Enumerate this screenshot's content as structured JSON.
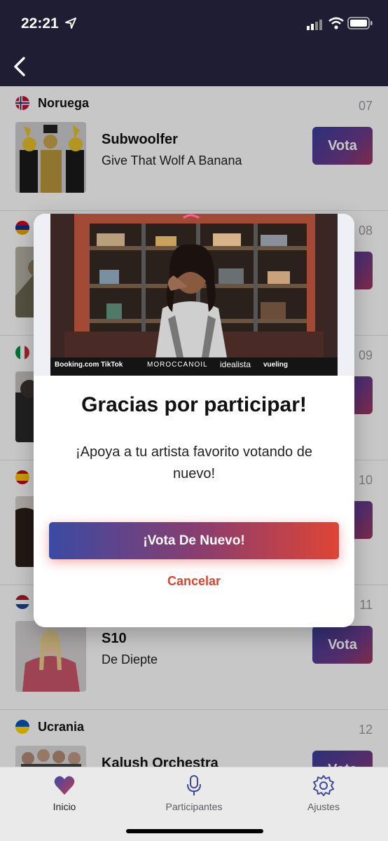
{
  "status_bar": {
    "time": "22:21",
    "icons": [
      "location-arrow-icon",
      "cellular-signal-icon",
      "wifi-icon",
      "battery-icon"
    ]
  },
  "nav": {
    "back_icon": "chevron-left-icon"
  },
  "entries": [
    {
      "country": "Noruega",
      "number": "07",
      "artist": "Subwoolfer",
      "song": "Give That Wolf A Banana",
      "vote": "Vota"
    },
    {
      "country": "",
      "number": "08",
      "artist": "",
      "song": "",
      "vote": ""
    },
    {
      "country": "",
      "number": "09",
      "artist": "",
      "song": "",
      "vote": ""
    },
    {
      "country": "",
      "number": "10",
      "artist": "",
      "song": "",
      "vote": ""
    },
    {
      "country": "",
      "number": "11",
      "artist": "S10",
      "song": "De Diepte",
      "vote": "Vota"
    },
    {
      "country": "Ucrania",
      "number": "12",
      "artist": "Kalush Orchestra",
      "song": "",
      "vote": "Vota"
    }
  ],
  "modal": {
    "sponsors": [
      "Booking.com",
      "TikTok",
      "MOROCCANOIL",
      "idealista",
      "vueling"
    ],
    "title": "Gracias por participar!",
    "message": "¡Apoya a tu artista favorito votando de nuevo!",
    "primary_button": "¡Vota De Nuevo!",
    "cancel_button": "Cancelar"
  },
  "tabs": [
    {
      "label": "Inicio",
      "icon": "heart-icon",
      "active": true
    },
    {
      "label": "Participantes",
      "icon": "microphone-icon",
      "active": false
    },
    {
      "label": "Ajustes",
      "icon": "gear-icon",
      "active": false
    }
  ],
  "colors": {
    "header": "#1f1d33",
    "accent_red": "#d9432f",
    "accent_blue": "#3b4aa3"
  }
}
